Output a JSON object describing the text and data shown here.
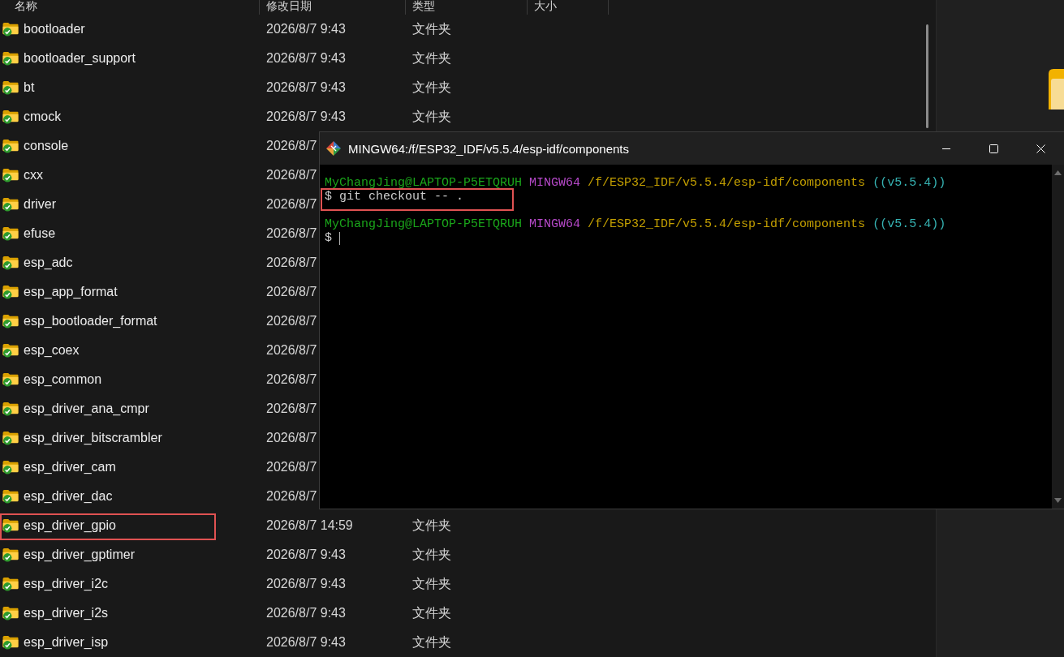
{
  "explorer": {
    "columns": [
      "名称",
      "修改日期",
      "类型",
      "大小"
    ],
    "rows": [
      {
        "name": "bootloader",
        "modified": "2026/8/7 9:43",
        "type": "文件夹",
        "highlighted": false
      },
      {
        "name": "bootloader_support",
        "modified": "2026/8/7 9:43",
        "type": "文件夹",
        "highlighted": false
      },
      {
        "name": "bt",
        "modified": "2026/8/7 9:43",
        "type": "文件夹",
        "highlighted": false
      },
      {
        "name": "cmock",
        "modified": "2026/8/7 9:43",
        "type": "文件夹",
        "highlighted": false
      },
      {
        "name": "console",
        "modified": "2026/8/7",
        "highlighted": false
      },
      {
        "name": "cxx",
        "modified": "2026/8/7",
        "highlighted": false
      },
      {
        "name": "driver",
        "modified": "2026/8/7",
        "highlighted": false
      },
      {
        "name": "efuse",
        "modified": "2026/8/7",
        "highlighted": false
      },
      {
        "name": "esp_adc",
        "modified": "2026/8/7",
        "highlighted": false
      },
      {
        "name": "esp_app_format",
        "modified": "2026/8/7",
        "highlighted": false
      },
      {
        "name": "esp_bootloader_format",
        "modified": "2026/8/7",
        "highlighted": false
      },
      {
        "name": "esp_coex",
        "modified": "2026/8/7",
        "highlighted": false
      },
      {
        "name": "esp_common",
        "modified": "2026/8/7",
        "highlighted": false
      },
      {
        "name": "esp_driver_ana_cmpr",
        "modified": "2026/8/7",
        "highlighted": false
      },
      {
        "name": "esp_driver_bitscrambler",
        "modified": "2026/8/7",
        "highlighted": false
      },
      {
        "name": "esp_driver_cam",
        "modified": "2026/8/7",
        "highlighted": false
      },
      {
        "name": "esp_driver_dac",
        "modified": "2026/8/7",
        "highlighted": false
      },
      {
        "name": "esp_driver_gpio",
        "modified": "2026/8/7 14:59",
        "type": "文件夹",
        "highlighted": true
      },
      {
        "name": "esp_driver_gptimer",
        "modified": "2026/8/7 9:43",
        "type": "文件夹",
        "highlighted": false
      },
      {
        "name": "esp_driver_i2c",
        "modified": "2026/8/7 9:43",
        "type": "文件夹",
        "highlighted": false
      },
      {
        "name": "esp_driver_i2s",
        "modified": "2026/8/7 9:43",
        "type": "文件夹",
        "highlighted": false
      },
      {
        "name": "esp_driver_isp",
        "modified": "2026/8/7 9:43",
        "type": "文件夹",
        "highlighted": false
      }
    ]
  },
  "terminal": {
    "title": "MINGW64:/f/ESP32_IDF/v5.5.4/esp-idf/components",
    "lines": [
      {
        "kind": "prompt",
        "user": "MyChangJing@LAPTOP-P5ETQRUH",
        "system": "MINGW64",
        "path": "/f/ESP32_IDF/v5.5.4/esp-idf/components",
        "branch": "((v5.5.4))"
      },
      {
        "kind": "command",
        "sign": "$",
        "text": "git checkout -- .",
        "cursor": false,
        "highlighted": true
      },
      {
        "kind": "blank"
      },
      {
        "kind": "prompt",
        "user": "MyChangJing@LAPTOP-P5ETQRUH",
        "system": "MINGW64",
        "path": "/f/ESP32_IDF/v5.5.4/esp-idf/components",
        "branch": "((v5.5.4))"
      },
      {
        "kind": "command",
        "sign": "$",
        "cursor": true,
        "highlighted": false
      }
    ]
  }
}
